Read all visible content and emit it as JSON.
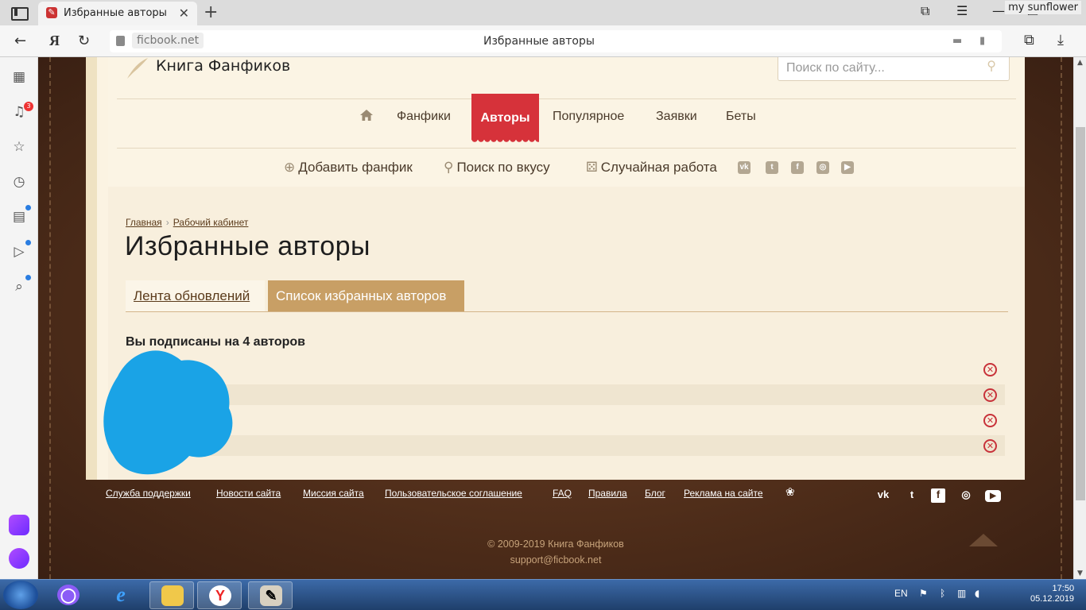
{
  "browser": {
    "tab_title": "Избранные авторы",
    "profile_name": "my sunflower",
    "address_domain": "ficbook.net",
    "address_page_title": "Избранные авторы",
    "yandex_logo": "Я",
    "notifications_badge": "3"
  },
  "site": {
    "name": "Книга Фанфиков",
    "search_placeholder": "Поиск по сайту..."
  },
  "main_nav": {
    "items": [
      "Фанфики",
      "Авторы",
      "Популярное",
      "Заявки",
      "Беты"
    ],
    "active": "Авторы"
  },
  "sub_nav": {
    "add_fanfic": "Добавить фанфик",
    "taste_search": "Поиск по вкусу",
    "random_work": "Случайная работа"
  },
  "breadcrumb": [
    "Главная",
    "Рабочий кабинет"
  ],
  "page_title": "Избранные авторы",
  "tabs": [
    "Лента обновлений",
    "Список избранных авторов"
  ],
  "active_tab": "Список избранных авторов",
  "subscription_text": "Вы подписаны на 4 авторов",
  "authors_count": 4,
  "footer": {
    "links": [
      "Служба поддержки",
      "Новости сайта",
      "Миссия сайта",
      "Пользовательское соглашение",
      "FAQ",
      "Правила",
      "Блог",
      "Реклама на сайте"
    ],
    "copyright": "© 2009-2019 Книга Фанфиков",
    "email": "support@ficbook.net"
  },
  "taskbar": {
    "lang": "EN",
    "time": "17:50",
    "date": "05.12.2019"
  },
  "colors": {
    "accent_red": "#d6323a",
    "tab_active": "#c89f65",
    "paper": "#f8efdd",
    "leather": "#4d2c19"
  }
}
